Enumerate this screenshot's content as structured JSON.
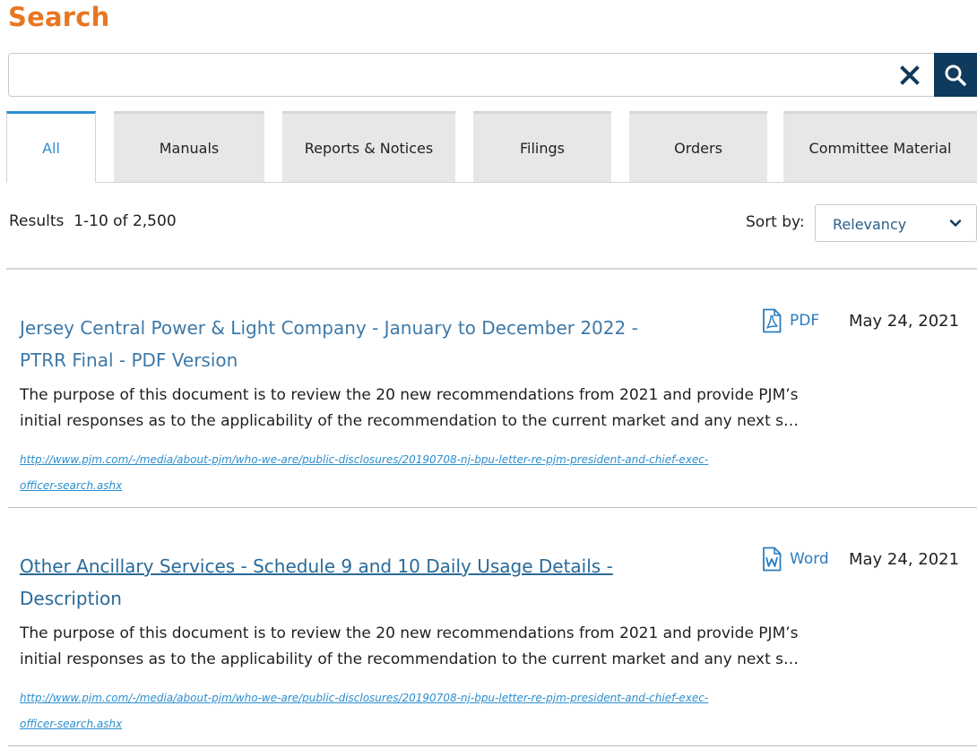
{
  "header": {
    "title": "Search"
  },
  "search": {
    "value": "",
    "placeholder": ""
  },
  "tabs": [
    {
      "label": "All",
      "active": true
    },
    {
      "label": "Manuals",
      "active": false
    },
    {
      "label": "Reports & Notices",
      "active": false
    },
    {
      "label": "Filings",
      "active": false
    },
    {
      "label": "Orders",
      "active": false
    },
    {
      "label": "Committee Material",
      "active": false
    }
  ],
  "results_bar": {
    "count_text": "Results  1-10 of 2,500",
    "sort_label": "Sort by:",
    "sort_value": "Relevancy"
  },
  "results": [
    {
      "title_line1": "Jersey Central Power & Light Company - January to December 2022 -",
      "title_line2": "PTRR Final - PDF Version",
      "type_label": "PDF",
      "type_icon": "pdf-file-icon",
      "date": "May 24, 2021",
      "desc_line1": "The purpose of this document is to review the 20 new recommendations from 2021 and provide PJM’s",
      "desc_line2": "initial responses as to the applicability of the recommendation to the current market and any next s…",
      "url_line1": "http://www.pjm.com/-/media/about-pjm/who-we-are/public-disclosures/20190708-nj-bpu-letter-re-pjm-president-and-chief-exec-",
      "url_line2": "officer-search.ashx"
    },
    {
      "title_line1": "Other Ancillary Services - Schedule 9 and 10 Daily Usage Details -",
      "title_line2": "Description",
      "type_label": "Word",
      "type_icon": "word-file-icon",
      "date": "May 24, 2021",
      "desc_line1": "The purpose of this document is to review the 20 new recommendations from 2021 and provide PJM’s",
      "desc_line2": "initial responses as to the applicability of the recommendation to the current market and any next s…",
      "url_line1": "http://www.pjm.com/-/media/about-pjm/who-we-are/public-disclosures/20190708-nj-bpu-letter-re-pjm-president-and-chief-exec-",
      "url_line2": "officer-search.ashx"
    }
  ],
  "colors": {
    "title_orange": "#e87722",
    "search_button": "#0e3a5d",
    "active_tab": "#2b8fd0",
    "link_blue": "#3e79a8"
  }
}
